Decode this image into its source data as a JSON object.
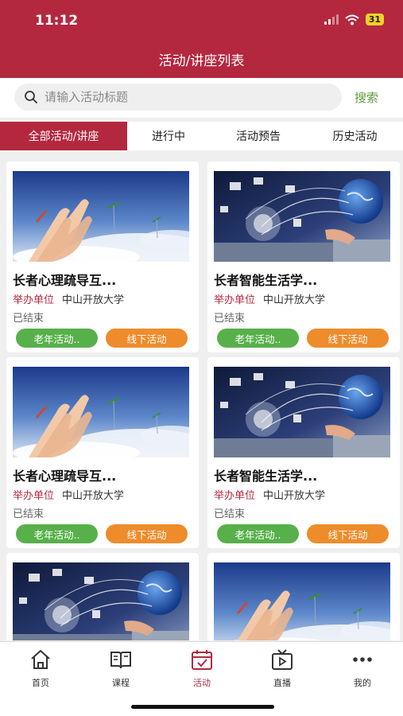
{
  "status": {
    "time": "11:12",
    "battery": "31"
  },
  "header": {
    "title": "活动/讲座列表"
  },
  "search": {
    "placeholder": "请输入活动标题",
    "button": "搜索"
  },
  "tabs": [
    {
      "label": "全部活动/讲座",
      "active": true
    },
    {
      "label": "进行中",
      "active": false
    },
    {
      "label": "活动预告",
      "active": false
    },
    {
      "label": "历史活动",
      "active": false
    }
  ],
  "cards": [
    {
      "title": "长者心理疏导互...",
      "organizer_label": "举办单位",
      "organizer": "中山开放大学",
      "status": "已结束",
      "tag1": "老年活动..",
      "tag2": "线下活动",
      "image": "hands-sky-image"
    },
    {
      "title": "长者智能生活学...",
      "organizer_label": "举办单位",
      "organizer": "中山开放大学",
      "status": "已结束",
      "tag1": "老年活动..",
      "tag2": "线下活动",
      "image": "globe-network-image"
    },
    {
      "title": "长者心理疏导互...",
      "organizer_label": "举办单位",
      "organizer": "中山开放大学",
      "status": "已结束",
      "tag1": "老年活动..",
      "tag2": "线下活动",
      "image": "hands-sky-image"
    },
    {
      "title": "长者智能生活学...",
      "organizer_label": "举办单位",
      "organizer": "中山开放大学",
      "status": "已结束",
      "tag1": "老年活动..",
      "tag2": "线下活动",
      "image": "globe-network-image"
    },
    {
      "image": "globe-network-image"
    },
    {
      "image": "hands-sky-image"
    }
  ],
  "tabbar": [
    {
      "label": "首页",
      "icon": "home-icon",
      "active": false
    },
    {
      "label": "课程",
      "icon": "book-icon",
      "active": false
    },
    {
      "label": "活动",
      "icon": "calendar-icon",
      "active": true
    },
    {
      "label": "直播",
      "icon": "live-tv-icon",
      "active": false
    },
    {
      "label": "我的",
      "icon": "more-dots-icon",
      "active": false
    }
  ],
  "colors": {
    "brand": "#b4283f",
    "green": "#57b04a",
    "orange": "#ee8c2b",
    "search_button": "#5a9c3a"
  }
}
